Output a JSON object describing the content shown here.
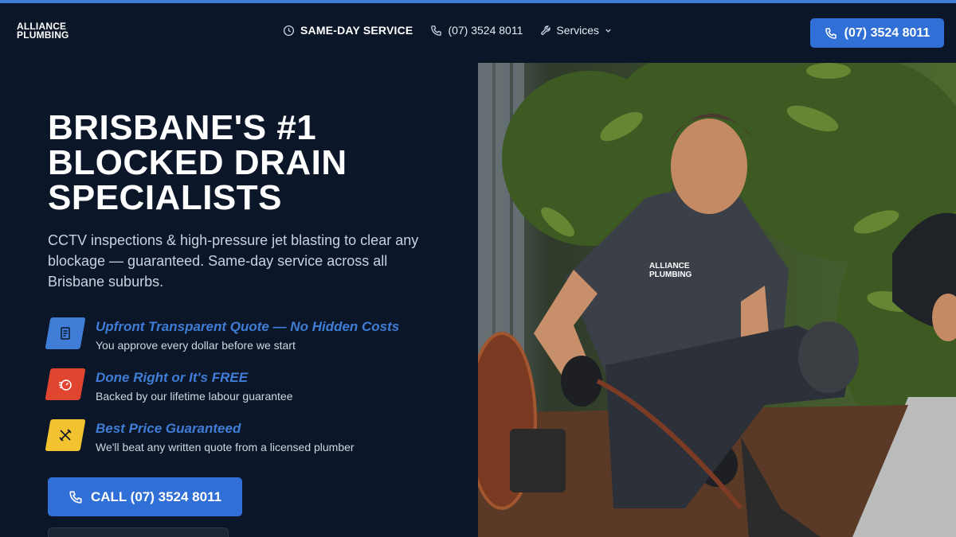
{
  "brand": {
    "logo_line1": "ALLIANCE",
    "logo_line2": "PLUMBING"
  },
  "nav": {
    "same_day": "SAME-DAY SERVICE",
    "phone": "(07) 3524 8011",
    "services": "Services"
  },
  "header_cta": {
    "label": "(07) 3524 8011"
  },
  "hero": {
    "title": "BRISBANE'S #1 BLOCKED DRAIN SPECIALISTS",
    "subtitle": "CCTV inspections & high-pressure jet blasting to clear any blockage — guaranteed. Same-day service across all Brisbane suburbs.",
    "features": [
      {
        "title": "Upfront Transparent Quote — No Hidden Costs",
        "desc": "You approve every dollar before we start",
        "icon": "document-icon",
        "color": "#3f7dd6"
      },
      {
        "title": "Done Right or It's FREE",
        "desc": "Backed by our lifetime labour guarantee",
        "icon": "gauge-icon",
        "color": "#e0452f"
      },
      {
        "title": "Best Price Guaranteed",
        "desc": "We'll beat any written quote from a licensed plumber",
        "icon": "tools-icon",
        "color": "#f2c230"
      }
    ],
    "cta_label": "CALL (07) 3524 8011"
  },
  "photo": {
    "shirt_logo_line1": "ALLIANCE",
    "shirt_logo_line2": "PLUMBING"
  },
  "colors": {
    "background": "#0b1628",
    "accent": "#2f6fd6",
    "topbar": "#3f7dd6"
  }
}
